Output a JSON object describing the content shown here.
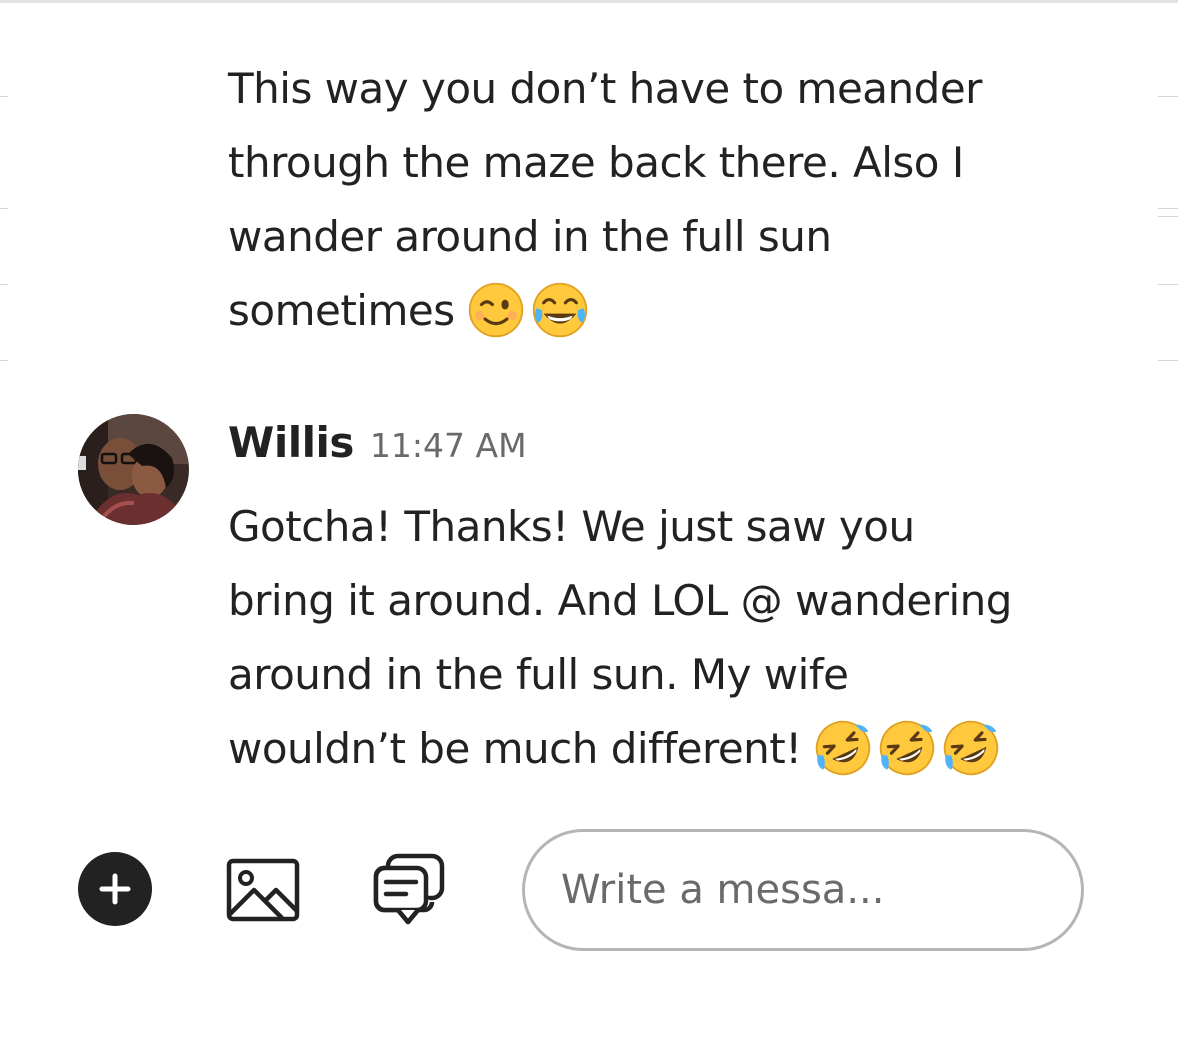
{
  "conversation": {
    "earlier_message": {
      "lines": [
        "This way you don’t have to meander",
        "through the maze back there. Also I",
        "wander around in the full sun",
        "sometimes"
      ],
      "emojis": [
        "winking-face",
        "face-with-tears-of-joy"
      ]
    },
    "latest_message": {
      "sender": "Willis",
      "time": "11:47 AM",
      "lines": [
        "Gotcha! Thanks! We just saw you",
        "bring it around. And LOL @ wandering",
        "around in the full sun. My wife",
        "wouldn’t be much different!"
      ],
      "emojis": [
        "rolling-on-the-floor-laughing",
        "rolling-on-the-floor-laughing",
        "rolling-on-the-floor-laughing"
      ]
    }
  },
  "composer": {
    "add_icon": "plus-icon",
    "photo_icon": "image-icon",
    "quick_reply_icon": "message-template-icon",
    "placeholder": "Write a messa..."
  },
  "colors": {
    "text": "#222222",
    "secondary_text": "#6a6a6a",
    "border": "#b5b5b5",
    "emoji_yellow": "#ffc83d"
  }
}
